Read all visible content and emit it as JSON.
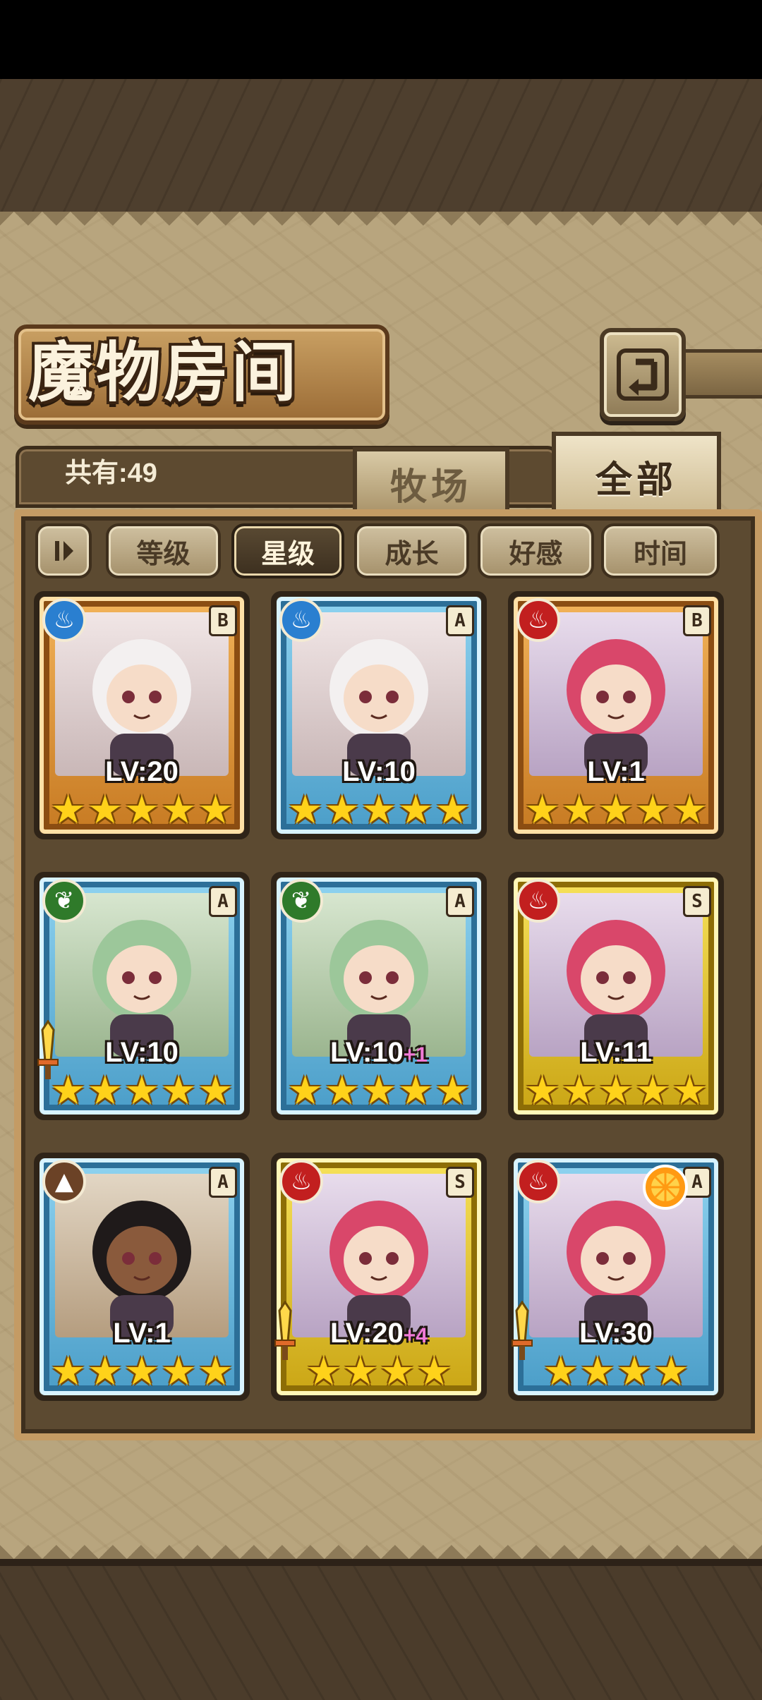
{
  "title": "魔物房间",
  "count_text": "共有:49",
  "tabs": {
    "ranch": "牧场",
    "all": "全部"
  },
  "sort_icon": "ascending-descending-toggle-icon",
  "filters": [
    "等级",
    "星级",
    "成长",
    "好感",
    "时间"
  ],
  "active_filter": "星级",
  "monsters": [
    {
      "element": "water",
      "rank": "B",
      "level": "LV:20",
      "bonus": "",
      "stars": 5,
      "frame": "orange",
      "weapon": false,
      "fruit": false
    },
    {
      "element": "water",
      "rank": "A",
      "level": "LV:10",
      "bonus": "",
      "stars": 5,
      "frame": "blue",
      "weapon": false,
      "fruit": false
    },
    {
      "element": "fire",
      "rank": "B",
      "level": "LV:1",
      "bonus": "",
      "stars": 5,
      "frame": "orange",
      "weapon": false,
      "fruit": false
    },
    {
      "element": "grass",
      "rank": "A",
      "level": "LV:10",
      "bonus": "",
      "stars": 5,
      "frame": "blue",
      "weapon": true,
      "fruit": false
    },
    {
      "element": "grass",
      "rank": "A",
      "level": "LV:10",
      "bonus": "+1",
      "stars": 5,
      "frame": "blue",
      "weapon": false,
      "fruit": false
    },
    {
      "element": "fire",
      "rank": "S",
      "level": "LV:11",
      "bonus": "",
      "stars": 5,
      "frame": "gold",
      "weapon": false,
      "fruit": false
    },
    {
      "element": "earth",
      "rank": "A",
      "level": "LV:1",
      "bonus": "",
      "stars": 5,
      "frame": "blue",
      "weapon": false,
      "fruit": false
    },
    {
      "element": "fire",
      "rank": "S",
      "level": "LV:20",
      "bonus": "+4",
      "stars": 4,
      "frame": "gold",
      "weapon": true,
      "fruit": false
    },
    {
      "element": "fire",
      "rank": "A",
      "level": "LV:30",
      "bonus": "",
      "stars": 4,
      "frame": "blue",
      "weapon": true,
      "fruit": true
    }
  ],
  "colors": {
    "water": "#2a7fd0",
    "fire": "#c21f1f",
    "grass": "#2f7a2a",
    "earth": "#6b4226",
    "star": "#ffd21a"
  }
}
